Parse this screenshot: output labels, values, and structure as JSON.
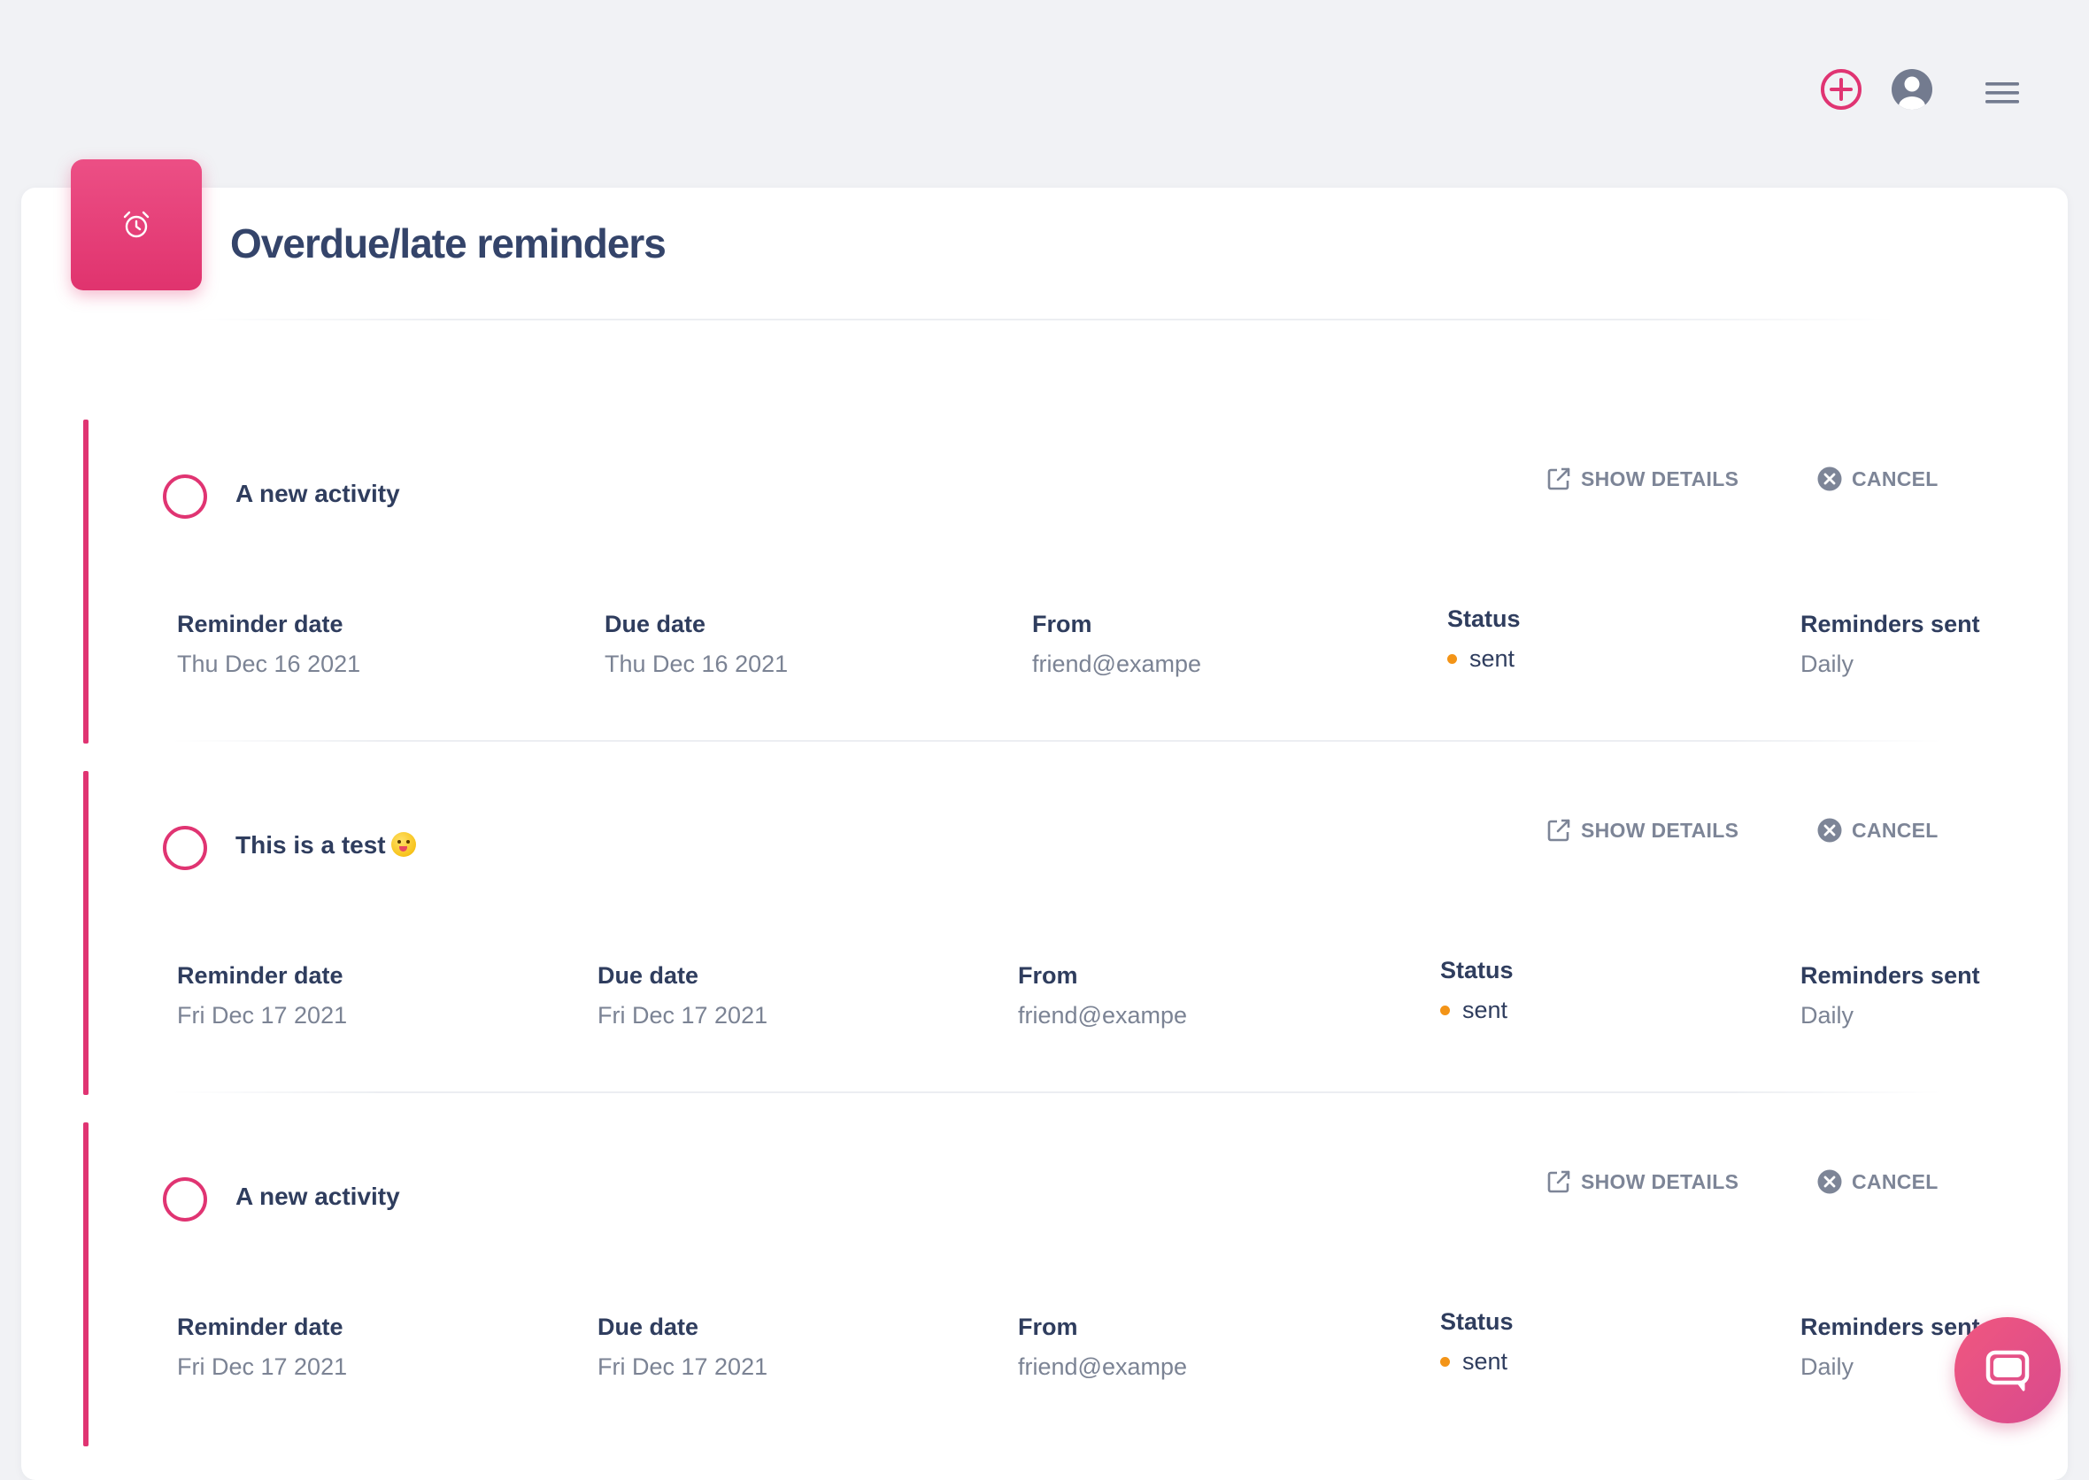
{
  "topbar": {
    "add_icon": "plus-circle-icon",
    "account_icon": "user-circle-icon",
    "menu_icon": "hamburger-menu-icon"
  },
  "header": {
    "icon": "alarm-clock-icon",
    "title": "Overdue/late reminders"
  },
  "colors": {
    "accent": "#e03472",
    "status_dot": "#f39417",
    "heading": "#2f3d5e",
    "muted": "#7b8394"
  },
  "columns": {
    "reminder_date": "Reminder date",
    "due_date": "Due date",
    "from": "From",
    "status": "Status",
    "reminders_sent": "Reminders sent"
  },
  "actions": {
    "show_details": "SHOW DETAILS",
    "cancel": "CANCEL"
  },
  "reminders": [
    {
      "title": "A new activity",
      "reminder_date": "Thu Dec 16 2021",
      "due_date": "Thu Dec 16 2021",
      "from": "friend@exampe",
      "status": "sent",
      "reminders_sent": "Daily"
    },
    {
      "title": "This is a test",
      "title_emoji": "winking-tongue-face-emoji",
      "reminder_date": "Fri Dec 17 2021",
      "due_date": "Fri Dec 17 2021",
      "from": "friend@exampe",
      "status": "sent",
      "reminders_sent": "Daily"
    },
    {
      "title": "A new activity",
      "reminder_date": "Fri Dec 17 2021",
      "due_date": "Fri Dec 17 2021",
      "from": "friend@exampe",
      "status": "sent",
      "reminders_sent": "Daily"
    }
  ],
  "chat": {
    "icon": "chat-bubble-icon"
  }
}
